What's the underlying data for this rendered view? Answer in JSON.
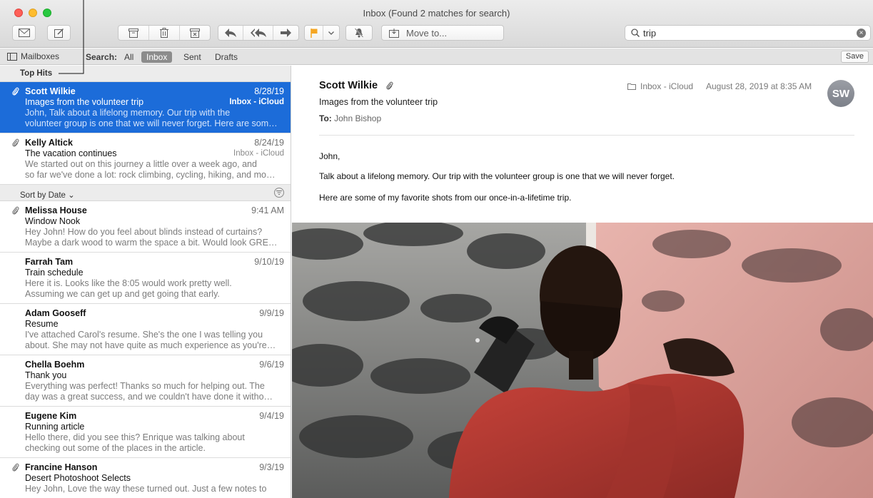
{
  "window": {
    "title": "Inbox (Found 2 matches for search)"
  },
  "toolbar": {
    "move_to_label": "Move to...",
    "search_value": "trip",
    "icons": [
      "compose-envelope-icon",
      "new-message-icon",
      "archive-icon",
      "trash-icon",
      "junk-icon",
      "reply-icon",
      "reply-all-icon",
      "forward-icon",
      "flag-icon",
      "mute-bell-icon",
      "move-to-icon",
      "search-icon",
      "clear-search-icon"
    ],
    "flag_color": "#f5a623"
  },
  "scopebar": {
    "mailboxes_label": "Mailboxes",
    "search_label": "Search:",
    "scopes": [
      "All",
      "Inbox",
      "Sent",
      "Drafts"
    ],
    "active_scope": "Inbox",
    "save_label": "Save"
  },
  "list": {
    "top_hits_label": "Top Hits",
    "sort_label": "Sort by Date ⌄",
    "top_hits": [
      {
        "from": "Scott Wilkie",
        "date": "8/28/19",
        "subject": "Images from the volunteer trip",
        "mailbox": "Inbox - iCloud",
        "preview1": "John, Talk about a lifelong memory. Our trip with the",
        "preview2": "volunteer group is one that we will never forget. Here are som…"
      },
      {
        "from": "Kelly Altick",
        "date": "8/24/19",
        "subject": "The vacation continues",
        "mailbox": "Inbox - iCloud",
        "preview1": "We started out on this journey a little over a week ago, and",
        "preview2": "so far we've done a lot: rock climbing, cycling, hiking, and mo…"
      }
    ],
    "messages": [
      {
        "from": "Melissa House",
        "date": "9:41 AM",
        "subject": "Window Nook",
        "preview1": "Hey John! How do you feel about blinds instead of curtains?",
        "preview2": "Maybe a dark wood to warm the space a bit. Would look GRE…"
      },
      {
        "from": "Farrah Tam",
        "date": "9/10/19",
        "subject": "Train schedule",
        "preview1": "Here it is. Looks like the 8:05 would work pretty well.",
        "preview2": "Assuming we can get up and get going that early."
      },
      {
        "from": "Adam Gooseff",
        "date": "9/9/19",
        "subject": "Resume",
        "preview1": "I've attached Carol's resume. She's the one I was telling you",
        "preview2": "about. She may not have quite as much experience as you're…"
      },
      {
        "from": "Chella Boehm",
        "date": "9/6/19",
        "subject": "Thank you",
        "preview1": "Everything was perfect! Thanks so much for helping out. The",
        "preview2": "day was a great success, and we couldn't have done it witho…"
      },
      {
        "from": "Eugene Kim",
        "date": "9/4/19",
        "subject": "Running article",
        "preview1": "Hello there, did you see this? Enrique was talking about",
        "preview2": "checking out some of the places in the article."
      },
      {
        "from": "Francine Hanson",
        "date": "9/3/19",
        "subject": "Desert Photoshoot Selects",
        "preview1": "Hey John, Love the way these turned out. Just a few notes to",
        "preview2": ""
      }
    ]
  },
  "reader": {
    "from": "Scott Wilkie",
    "subject": "Images from the volunteer trip",
    "to_label": "To:",
    "to": "John Bishop",
    "mailbox": "Inbox - iCloud",
    "date": "August 28, 2019 at 8:35 AM",
    "avatar_initials": "SW",
    "body": [
      "John,",
      "Talk about a lifelong memory. Our trip with the volunteer group is one that we will never forget.",
      "Here are some of my favorite shots from our once-in-a-lifetime trip."
    ]
  },
  "colors": {
    "selection": "#1c6cd9",
    "active_scope": "#8c8c8c"
  }
}
